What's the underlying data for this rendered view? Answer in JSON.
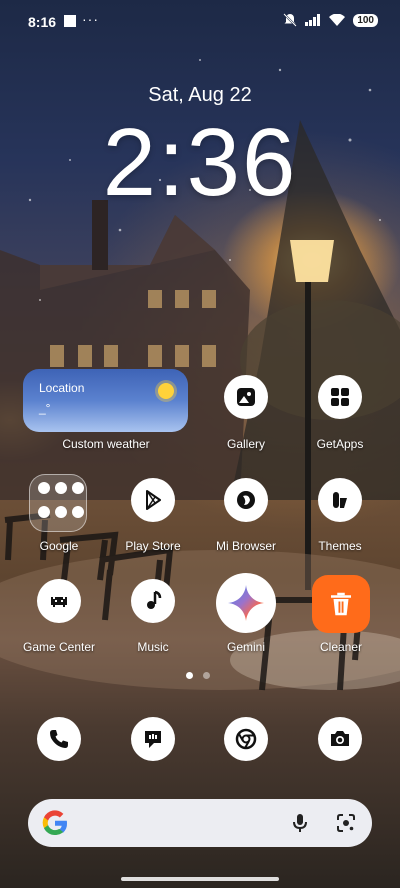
{
  "status_bar": {
    "time": "8:16",
    "more_dots": "···",
    "battery": "100"
  },
  "lockscreen": {
    "date": "Sat, Aug 22",
    "clock": "2:36"
  },
  "weather_widget": {
    "location": "Location",
    "value": "_°",
    "label": "Custom weather"
  },
  "apps": {
    "gallery": "Gallery",
    "getapps": "GetApps",
    "google": "Google",
    "play_store": "Play Store",
    "mi_browser": "Mi Browser",
    "themes": "Themes",
    "game_center": "Game Center",
    "music": "Music",
    "gemini": "Gemini",
    "cleaner": "Cleaner"
  },
  "dock": {
    "items": [
      "phone-icon",
      "messages-icon",
      "chrome-icon",
      "camera-icon"
    ]
  },
  "search": {
    "icons": [
      "google-g-icon",
      "mic-icon",
      "lens-icon"
    ]
  }
}
